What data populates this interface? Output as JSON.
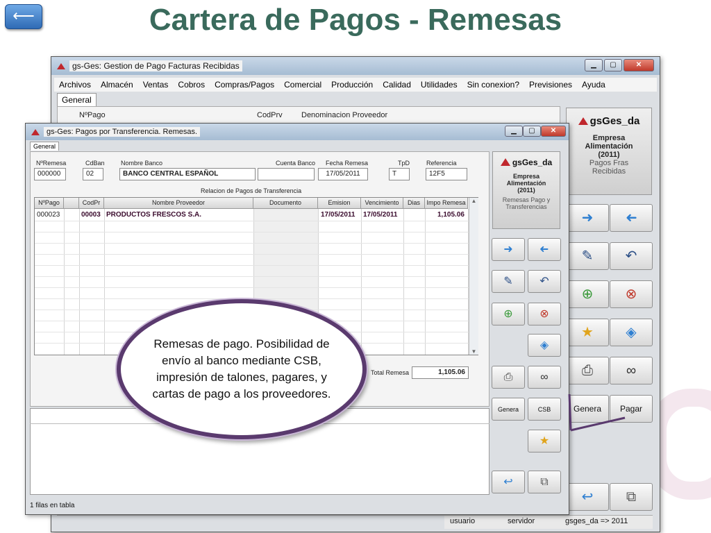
{
  "slide": {
    "back_glyph": "⟵",
    "title": "Cartera de Pagos - Remesas"
  },
  "main_window": {
    "title": "gs-Ges: Gestion de Pago Facturas Recibidas",
    "menu": [
      "Archivos",
      "Almacén",
      "Ventas",
      "Cobros",
      "Compras/Pagos",
      "Comercial",
      "Producción",
      "Calidad",
      "Utilidades",
      "Sin conexion?",
      "Previsiones",
      "Ayuda"
    ],
    "tab": "General",
    "labels": {
      "npago": "NºPago",
      "codprv": "CodPrv",
      "denominacion": "Denominacion Proveedor"
    },
    "brand": {
      "name": "gsGes_da",
      "line1": "Empresa",
      "line2": "Alimentación",
      "line3": "(2011)",
      "line4": "Pagos Fras",
      "line5": "Recibidas"
    },
    "buttons": {
      "genera": "Genera",
      "pagar": "Pagar"
    },
    "status": {
      "usuario": "usuario",
      "servidor": "servidor",
      "db": "gsges_da => 2011"
    }
  },
  "inner_window": {
    "title": "gs-Ges: Pagos por Transferencia. Remesas.",
    "tab": "General",
    "fields": {
      "nremesa": {
        "label": "NºRemesa",
        "value": "000000"
      },
      "cdban": {
        "label": "CdBan",
        "value": "02"
      },
      "nombre_banco": {
        "label": "Nombre Banco",
        "value": "BANCO CENTRAL ESPAÑOL"
      },
      "cuenta_banco": {
        "label": "Cuenta Banco",
        "value": ""
      },
      "fecha_remesa": {
        "label": "Fecha Remesa",
        "value": "17/05/2011"
      },
      "tpd": {
        "label": "TpD",
        "value": "T"
      },
      "referencia": {
        "label": "Referencia",
        "value": "12F5"
      }
    },
    "grid_title": "Relacion de Pagos de Transferencia",
    "columns": [
      "NºPago",
      "",
      "CodPr",
      "Nombre Proveedor",
      "Documento",
      "Emision",
      "Vencimiento",
      "Dias",
      "Impo Remesa"
    ],
    "rows": [
      {
        "npago": "000023",
        "flag": "",
        "codpr": "00003",
        "nombre": "PRODUCTOS FRESCOS S.A.",
        "documento": "",
        "emision": "17/05/2011",
        "vencimiento": "17/05/2011",
        "dias": "",
        "importe": "1,105.06"
      }
    ],
    "total_label": "Total Remesa",
    "total_value": "1,105.06",
    "brand": {
      "name": "gsGes_da",
      "line1": "Empresa",
      "line2": "Alimentación",
      "line3": "(2011)",
      "line4": "Remesas Pago y",
      "line5": "Transferencias"
    },
    "buttons": {
      "genera": "Genera",
      "csb": "CSB"
    },
    "status": "1 filas en tabla"
  },
  "callout": {
    "text": "Remesas de pago. Posibilidad de envío al banco mediante CSB, impresión de talones, pagares, y cartas de pago a los proveedores."
  }
}
